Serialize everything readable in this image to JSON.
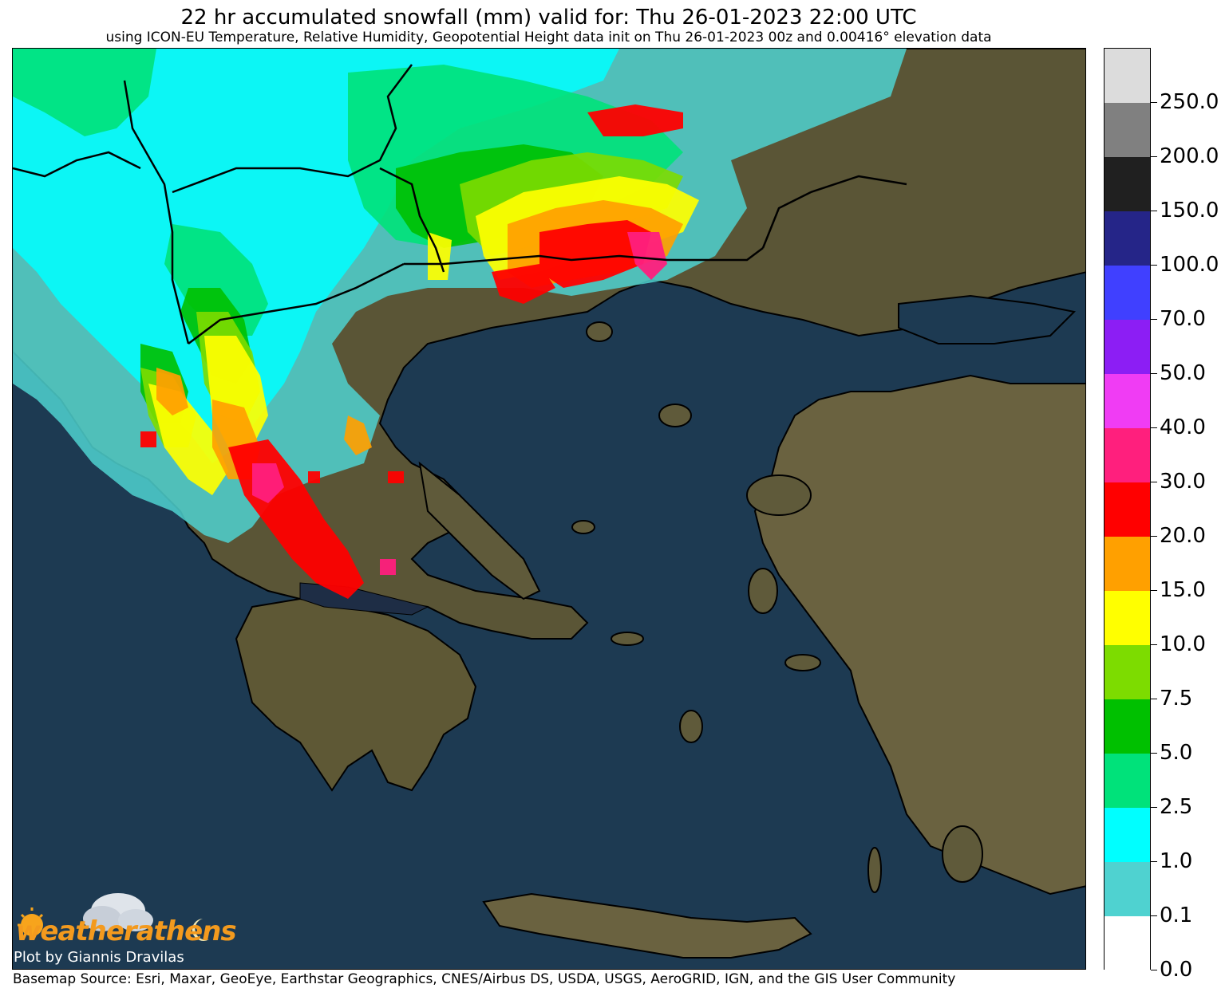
{
  "title": "22 hr accumulated snowfall (mm) valid for: Thu 26-01-2023 22:00 UTC",
  "subtitle": "using ICON-EU Temperature, Relative Humidity, Geopotential Height data init on Thu 26-01-2023 00z and 0.00416° elevation data",
  "logo_text": "weatherathens",
  "plot_credit": "Plot by Giannis Dravilas",
  "basemap_source": "Basemap Source: Esri, Maxar, GeoEye, Earthstar Geographics, CNES/Airbus DS, USDA, USGS, AeroGRID, IGN, and the GIS User Community",
  "colorbar": {
    "ticks": [
      "0.0",
      "0.1",
      "1.0",
      "2.5",
      "5.0",
      "7.5",
      "10.0",
      "15.0",
      "20.0",
      "30.0",
      "40.0",
      "50.0",
      "70.0",
      "100.0",
      "150.0",
      "200.0",
      "250.0"
    ],
    "colors": [
      "#ffffff",
      "#4fd2d0",
      "#00ffff",
      "#00e27a",
      "#00c000",
      "#7ddc00",
      "#ffff00",
      "#ffa000",
      "#ff0000",
      "#ff1f7d",
      "#f03cf4",
      "#8c1ef4",
      "#4040ff",
      "#252588",
      "#202020",
      "#808080",
      "#dcdcdc"
    ]
  },
  "colors": {
    "sea": "#1d3a52",
    "land": "#5f5a3a",
    "border": "#000000"
  }
}
